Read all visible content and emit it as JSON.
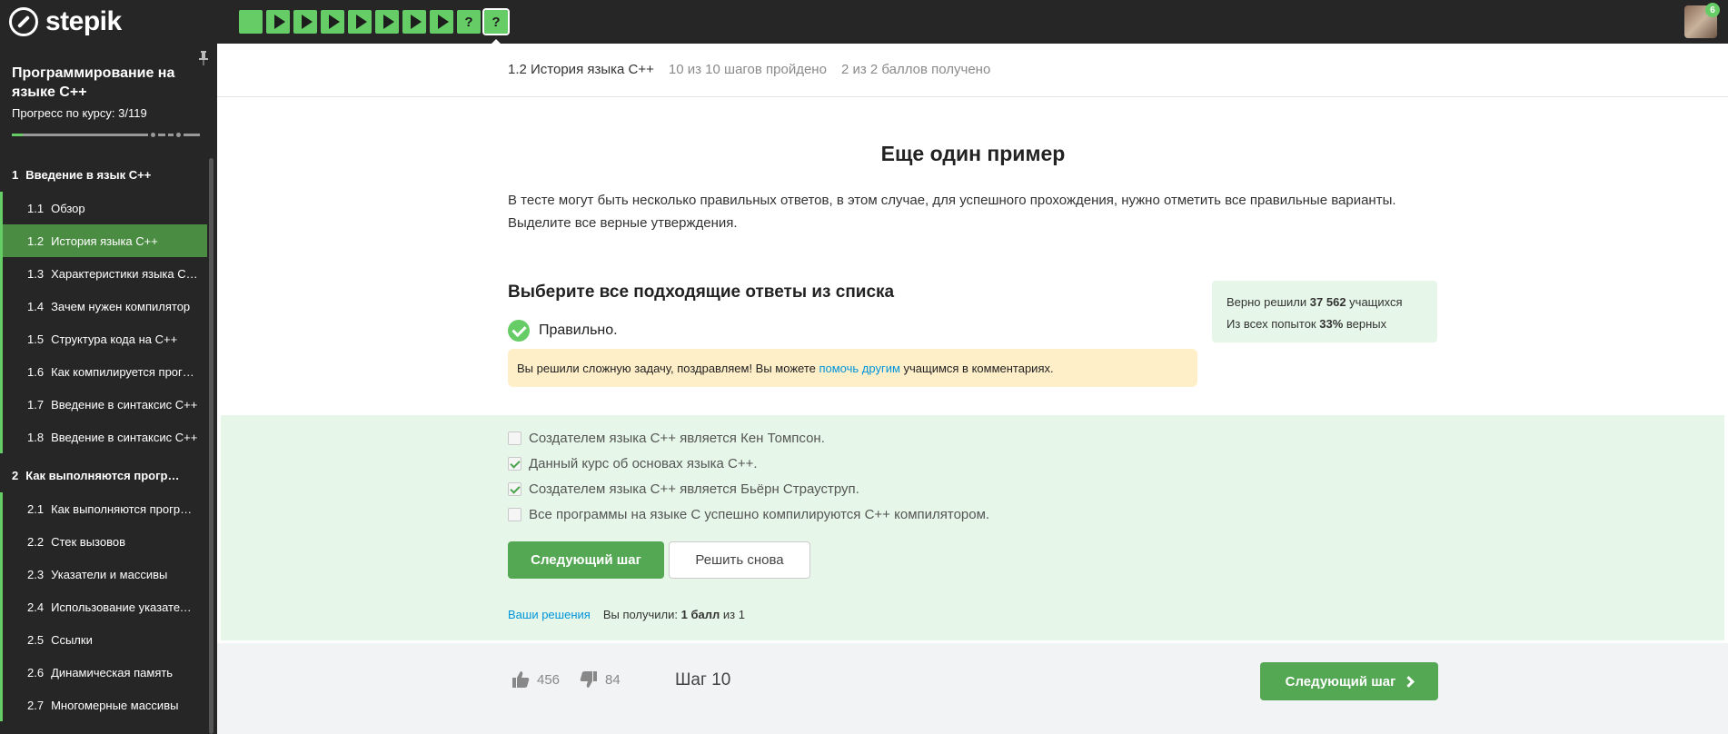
{
  "brand": {
    "name": "stepik"
  },
  "steps": [
    {
      "type": "text"
    },
    {
      "type": "video"
    },
    {
      "type": "video"
    },
    {
      "type": "video"
    },
    {
      "type": "video"
    },
    {
      "type": "video"
    },
    {
      "type": "video"
    },
    {
      "type": "video"
    },
    {
      "type": "quiz",
      "glyph": "?"
    },
    {
      "type": "quiz",
      "glyph": "?",
      "current": true
    }
  ],
  "user": {
    "notifications": "6"
  },
  "sidebar": {
    "course_title": "Программирование на языке С++",
    "progress_label": "Прогресс по курсу:",
    "progress_value": "3/119",
    "modules": [
      {
        "num": "1",
        "title": "Введение в язык С++"
      },
      {
        "num": "2",
        "title": "Как выполняются программы"
      }
    ],
    "lessons": [
      {
        "num": "1.1",
        "title": "Обзор"
      },
      {
        "num": "1.2",
        "title": "История языка С++",
        "active": true
      },
      {
        "num": "1.3",
        "title": "Характеристики языка С++"
      },
      {
        "num": "1.4",
        "title": "Зачем нужен компилятор"
      },
      {
        "num": "1.5",
        "title": "Структура кода на С++"
      },
      {
        "num": "1.6",
        "title": "Как компилируется программа"
      },
      {
        "num": "1.7",
        "title": "Введение в синтаксис С++"
      },
      {
        "num": "1.8",
        "title": "Введение в синтаксис С++"
      },
      {
        "num": "2.1",
        "title": "Как выполняются программы"
      },
      {
        "num": "2.2",
        "title": "Стек вызовов"
      },
      {
        "num": "2.3",
        "title": "Указатели и массивы"
      },
      {
        "num": "2.4",
        "title": "Использование указателей"
      },
      {
        "num": "2.5",
        "title": "Ссылки"
      },
      {
        "num": "2.6",
        "title": "Динамическая память"
      },
      {
        "num": "2.7",
        "title": "Многомерные массивы"
      }
    ]
  },
  "header": {
    "lesson_title": "1.2 История языка С++",
    "steps_done": "10 из 10 шагов пройдено",
    "score": "2 из 2 баллов  получено"
  },
  "content": {
    "title": "Еще один пример",
    "text": "В тесте могут быть несколько правильных ответов, в этом случае, для успешного прохождения, нужно отметить все правильные варианты. Выделите все верные утверждения."
  },
  "quiz": {
    "title": "Выберите все подходящие ответы из списка",
    "status": "Правильно.",
    "congrats_before": "Вы решили сложную задачу, поздравляем! Вы можете ",
    "congrats_link": "помочь другим",
    "congrats_after": " учащимся в комментариях.",
    "stats": {
      "solved_label": "Верно решили",
      "solved_value": "37 562",
      "solved_suffix": "учащихся",
      "attempts_label": "Из всех попыток",
      "attempts_value": "33%",
      "attempts_suffix": "верных"
    },
    "options": [
      {
        "text": "Создателем языка С++ является Кен Томпсон.",
        "checked": false
      },
      {
        "text": "Данный курс об основах языка С++.",
        "checked": true
      },
      {
        "text": "Создателем языка С++ является Бьёрн Страуструп.",
        "checked": true
      },
      {
        "text": "Все программы на языке С успешно компилируются С++ компилятором.",
        "checked": false
      }
    ],
    "next_label": "Следующий шаг",
    "retry_label": "Решить снова",
    "solutions_link": "Ваши решения",
    "result_label": "Вы получили:",
    "result_value": "1 балл",
    "result_suffix": "из 1"
  },
  "footer": {
    "likes": "456",
    "dislikes": "84",
    "step_label": "Шаг 10",
    "next_label": "Следующий шаг"
  },
  "colors": {
    "accent": "#66cc66",
    "button": "#54a753",
    "link": "#0094da",
    "success_bg": "#e6f7e9",
    "notice_bg": "#ffefc9"
  }
}
